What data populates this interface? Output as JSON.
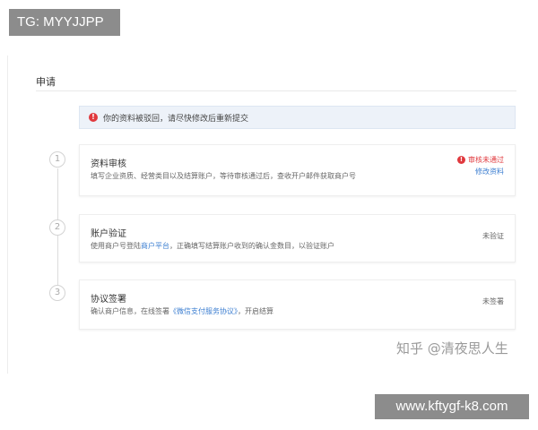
{
  "overlays": {
    "tg_label": "TG: MYYJJPP",
    "url_label": "www.kftygf-k8.com",
    "watermark": "知乎 @清夜思人生"
  },
  "page": {
    "section_title": "申请"
  },
  "alert": {
    "icon": "exclamation-icon",
    "text": "你的资料被驳回，请尽快修改后重新提交"
  },
  "steps": [
    {
      "number": "1",
      "title": "资料审核",
      "description": "填写企业资质、经营类目以及结算账户，等待审核通过后，查收开户邮件获取商户号",
      "status": "审核未通过",
      "status_color": "#e0393e",
      "action": "修改资料"
    },
    {
      "number": "2",
      "title": "账户验证",
      "description_prefix": "使用商户号登陆",
      "description_link": "商户平台",
      "description_suffix": "，正确填写结算账户收到的确认金数目，以验证账户",
      "status": "未验证"
    },
    {
      "number": "3",
      "title": "协议签署",
      "description_prefix": "确认商户信息，在线签署",
      "description_link": "《微信支付服务协议》",
      "description_suffix": "，开启结算",
      "status": "未签署"
    }
  ],
  "colors": {
    "accent_link": "#3d7fd1",
    "error": "#e0393e",
    "alert_bg": "#edf2f9"
  }
}
